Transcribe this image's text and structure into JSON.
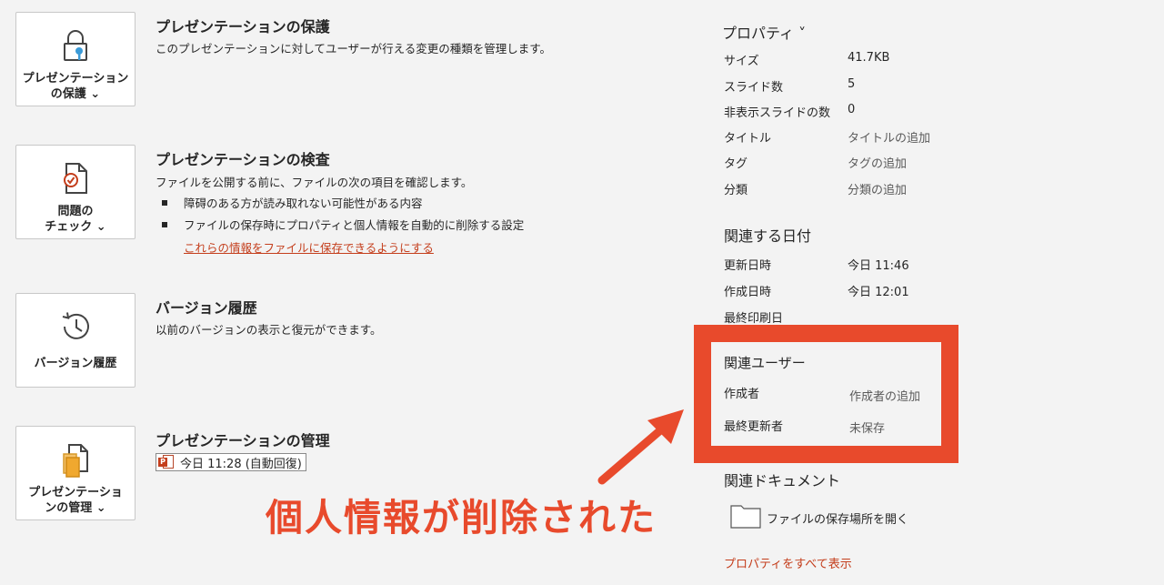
{
  "sections": {
    "protect": {
      "tile_label": "プレゼンテーション\nの保護 ⌄",
      "title": "プレゼンテーションの保護",
      "desc": "このプレゼンテーションに対してユーザーが行える変更の種類を管理します。"
    },
    "inspect": {
      "tile_label": "問題の\nチェック ⌄",
      "title": "プレゼンテーションの検査",
      "desc": "ファイルを公開する前に、ファイルの次の項目を確認します。",
      "bullets": [
        "障碍のある方が読み取れない可能性がある内容",
        "ファイルの保存時にプロパティと個人情報を自動的に削除する設定"
      ],
      "link": "これらの情報をファイルに保存できるようにする"
    },
    "history": {
      "tile_label": "バージョン履歴",
      "title": "バージョン履歴",
      "desc": "以前のバージョンの表示と復元ができます。"
    },
    "manage": {
      "tile_label": "プレゼンテーショ\nンの管理 ⌄",
      "title": "プレゼンテーションの管理",
      "version_entry": "今日 11:28 (自動回復)"
    }
  },
  "properties": {
    "heading": "プロパティ ˅",
    "rows": [
      {
        "label": "サイズ",
        "value": "41.7KB"
      },
      {
        "label": "スライド数",
        "value": "5"
      },
      {
        "label": "非表示スライドの数",
        "value": "0"
      },
      {
        "label": "タイトル",
        "value": "タイトルの追加"
      },
      {
        "label": "タグ",
        "value": "タグの追加"
      },
      {
        "label": "分類",
        "value": "分類の追加"
      }
    ]
  },
  "dates": {
    "heading": "関連する日付",
    "rows": [
      {
        "label": "更新日時",
        "value": "今日 11:46"
      },
      {
        "label": "作成日時",
        "value": "今日 12:01"
      },
      {
        "label": "最終印刷日",
        "value": ""
      }
    ]
  },
  "people": {
    "heading": "関連ユーザー",
    "rows": [
      {
        "label": "作成者",
        "value": "作成者の追加"
      },
      {
        "label": "最終更新者",
        "value": "未保存"
      }
    ]
  },
  "documents": {
    "heading": "関連ドキュメント",
    "open_location": "ファイルの保存場所を開く"
  },
  "show_all_props": "プロパティをすべて表示",
  "annotation": "個人情報が削除された",
  "colors": {
    "accent": "#e84a2c",
    "link": "#c43e1c"
  }
}
